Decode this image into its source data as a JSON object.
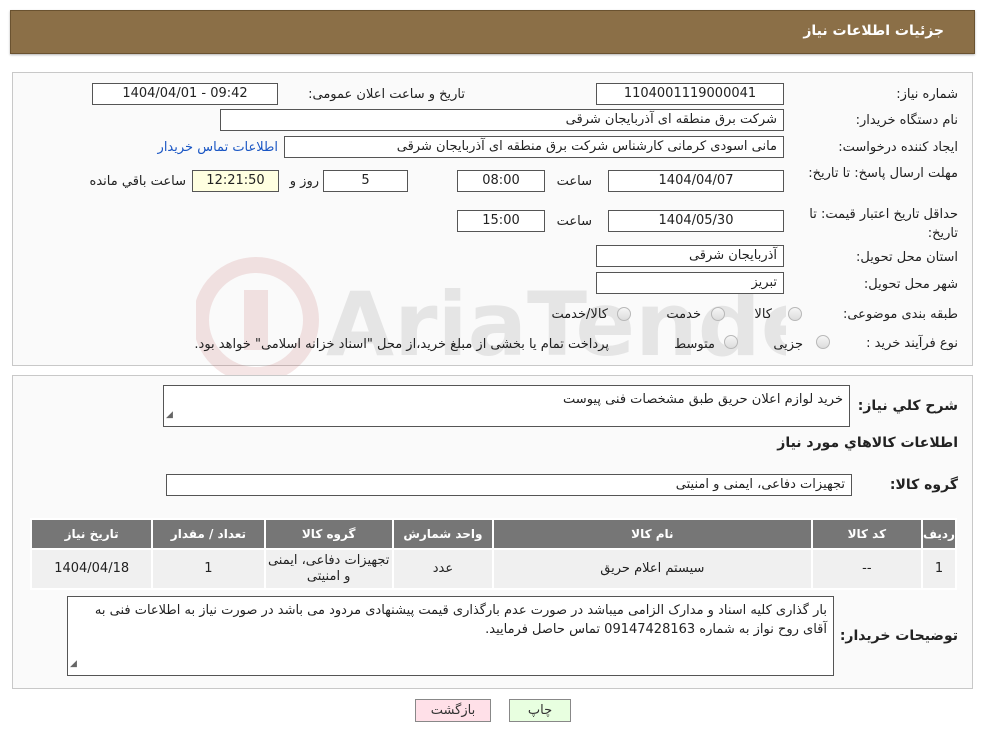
{
  "header": {
    "title": "جزئیات اطلاعات نیاز"
  },
  "details": {
    "need_number_label": "شماره نیاز:",
    "need_number": "1104001119000041",
    "announce_label": "تاریخ و ساعت اعلان عمومی:",
    "announce_value": "1404/04/01 - 09:42",
    "buyer_org_label": "نام دستگاه خریدار:",
    "buyer_org": "شرکت برق منطقه ای آذربایجان شرقی",
    "creator_label": "ایجاد کننده درخواست:",
    "creator": "مانی اسودی کرمانی کارشناس شرکت برق منطقه ای آذربایجان شرقی",
    "contact_link": "اطلاعات تماس خریدار",
    "deadline_label": "مهلت ارسال پاسخ: تا تاریخ:",
    "deadline_date": "1404/04/07",
    "time_label": "ساعت",
    "deadline_time": "08:00",
    "days_value": "5",
    "days_label": "روز و",
    "remaining_time": "12:21:50",
    "remaining_label": "ساعت باقي مانده",
    "validity_label": "حداقل تاریخ اعتبار قیمت: تا تاریخ:",
    "validity_date": "1404/05/30",
    "validity_time": "15:00",
    "province_label": "استان محل تحویل:",
    "province": "آذربایجان شرقی",
    "city_label": "شهر محل تحویل:",
    "city": "تبریز",
    "category_label": "طبقه بندی موضوعی:",
    "category_options": [
      "کالا",
      "خدمت",
      "کالا/خدمت"
    ],
    "process_label": "نوع فرآیند خرید :",
    "process_options": [
      "جزیی",
      "متوسط"
    ],
    "process_note": "پرداخت تمام یا بخشی از مبلغ خرید،از محل \"اسناد خزانه اسلامی\" خواهد بود."
  },
  "summary": {
    "general_desc_label": "شرح کلي نياز:",
    "general_desc": "خرید لوازم اعلان حریق طبق مشخصات فنی پیوست",
    "goods_info_title": "اطلاعات کالاهاي مورد نياز",
    "goods_group_label": "گروه کالا:",
    "goods_group": "تجهیزات دفاعی، ایمنی و امنیتی"
  },
  "table": {
    "headers": [
      "ردیف",
      "کد کالا",
      "نام کالا",
      "واحد شمارش",
      "گروه کالا",
      "تعداد / مقدار",
      "تاریخ نیاز"
    ],
    "rows": [
      [
        "1",
        "--",
        "سیستم اعلام حریق",
        "عدد",
        "تجهیزات دفاعی، ایمنی و امنیتی",
        "1",
        "1404/04/18"
      ]
    ]
  },
  "buyer_notes": {
    "label": "توضیحات خریدار:",
    "text": "بار گذاری کلیه اسناد و مدارک الزامی میباشد در صورت عدم بارگذاری قیمت پیشنهادی مردود می باشد در صورت نیاز به اطلاعات فنی به آقای روح نواز به شماره 09147428163 تماس حاصل فرمایید."
  },
  "buttons": {
    "print": "چاپ",
    "back": "بازگشت"
  },
  "icons": {
    "resize": "resize-grip-icon",
    "watermark": "ariatender-logo-icon"
  },
  "watermark_text": "AriaTender.neT"
}
